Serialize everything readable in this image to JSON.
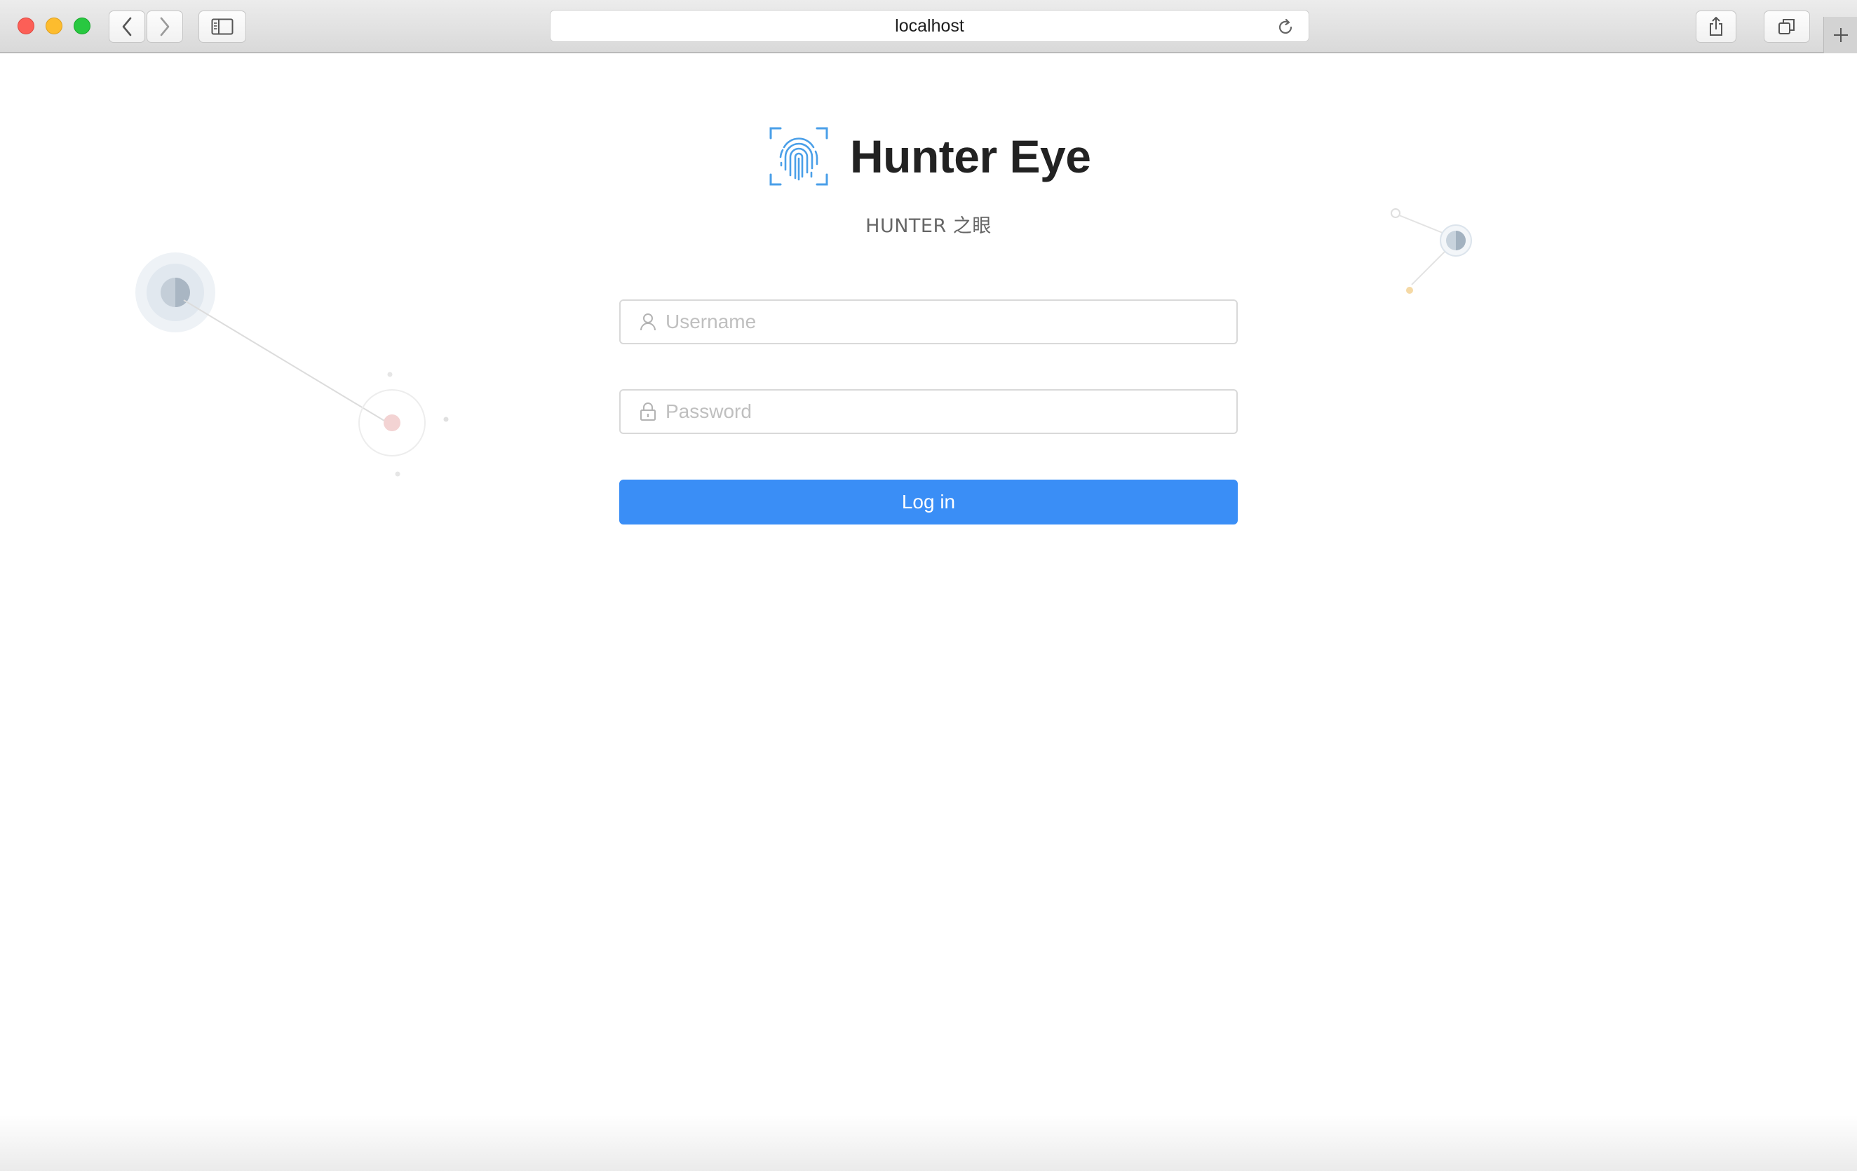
{
  "browser": {
    "url": "localhost",
    "icons": {
      "back": "chevron-left-icon",
      "forward": "chevron-right-icon",
      "sidebar": "sidebar-icon",
      "reload": "reload-icon",
      "share": "share-icon",
      "tabs": "tabs-overview-icon",
      "new_tab": "plus-icon"
    }
  },
  "login": {
    "brand_title": "Hunter Eye",
    "subtitle": "HUNTER 之眼",
    "logo_icon": "fingerprint-icon",
    "username_placeholder": "Username",
    "username_icon": "user-icon",
    "password_placeholder": "Password",
    "password_icon": "lock-icon",
    "login_label": "Log in"
  },
  "colors": {
    "primary": "#3a8ef6",
    "logo_blue": "#4a9fe8",
    "title_text": "#222222",
    "placeholder": "#bfbfbf",
    "border": "#d9d9d9"
  }
}
